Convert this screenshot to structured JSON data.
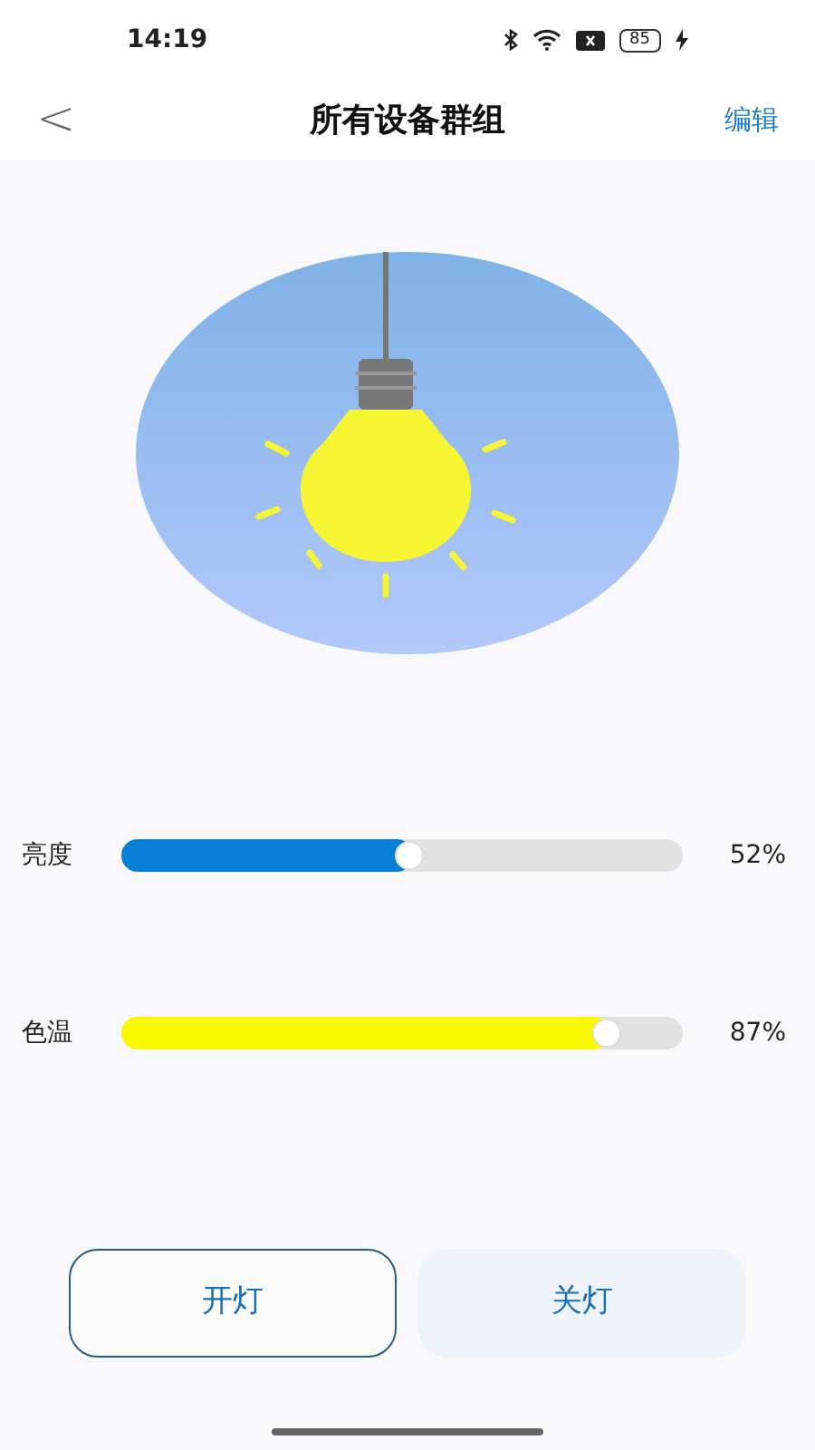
{
  "status_bar": {
    "time": "14:19",
    "battery": "85"
  },
  "nav": {
    "back": "<",
    "title": "所有设备群组",
    "action": "编辑"
  },
  "sliders": [
    {
      "kind": "brightness",
      "label": "亮度",
      "level": 0.52,
      "reading": "52%"
    },
    {
      "kind": "temperature",
      "label": "色温",
      "level": 0.87,
      "reading": "87%"
    }
  ],
  "buttons": [
    {
      "label": "开灯",
      "selected": true
    },
    {
      "label": "关灯",
      "selected": false
    }
  ]
}
